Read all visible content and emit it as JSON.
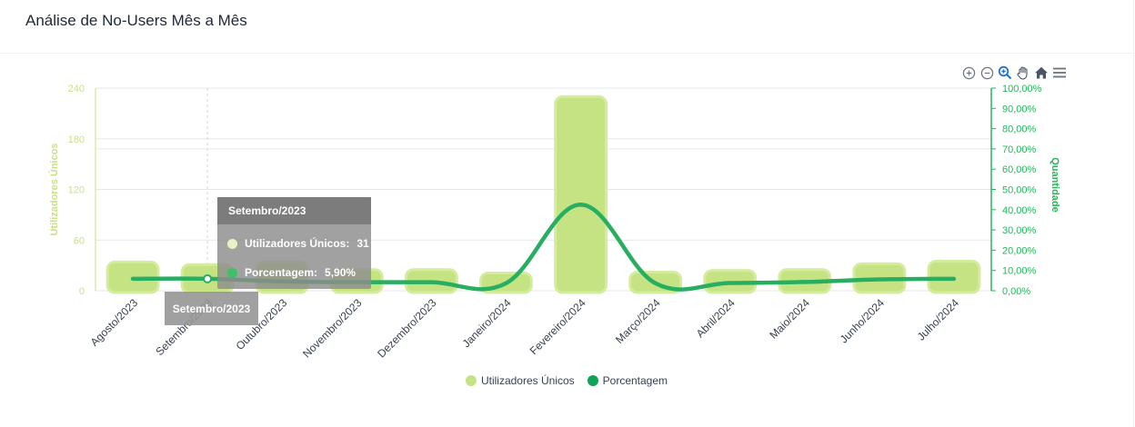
{
  "header": {
    "title": "Análise de No-Users Mês a Mês"
  },
  "toolbar": {
    "icons": [
      "zoom-in-icon",
      "zoom-out-icon",
      "selection-zoom-icon",
      "pan-hand-icon",
      "home-reset-icon",
      "menu-icon"
    ]
  },
  "colors": {
    "bar": "#c5e383",
    "line": "#27ae60",
    "left_axis": "#c5e383",
    "right_axis": "#22b859",
    "grid": "#e5e7eb",
    "tooltip_bg": "#8c8c8c"
  },
  "chart_data": {
    "type": "bar",
    "categories": [
      "Agosto/2023",
      "Setembro/2023",
      "Outubro/2023",
      "Novembro/2023",
      "Dezembro/2023",
      "Janeiro/2024",
      "Fevereiro/2024",
      "Março/2024",
      "Abril/2024",
      "Maio/2024",
      "Junho/2024",
      "Julho/2024"
    ],
    "series": [
      {
        "name": "Utilizadores Únicos",
        "axis": "left",
        "type": "bar",
        "values": [
          34,
          31,
          34,
          25,
          25,
          21,
          230,
          22,
          24,
          25,
          32,
          35
        ]
      },
      {
        "name": "Porcentagem",
        "axis": "right",
        "type": "line",
        "values": [
          5.9,
          5.9,
          4.6,
          4.2,
          4.2,
          3.7,
          42.5,
          3.7,
          3.8,
          4.3,
          5.6,
          5.9
        ]
      }
    ],
    "ylabel": "Utilizadores Únicos",
    "y2label": "Quantidade",
    "ylim": [
      0,
      240
    ],
    "y2lim": [
      0,
      100
    ],
    "yticks": [
      "0",
      "60",
      "120",
      "180",
      "240"
    ],
    "y2ticks": [
      "0,00%",
      "10,00%",
      "20,00%",
      "30,00%",
      "40,00%",
      "50,00%",
      "60,00%",
      "70,00%",
      "80,00%",
      "90,00%",
      "100,00%"
    ],
    "grid": true,
    "legend": "bottom-center",
    "tooltip": {
      "title": "Setembro/2023",
      "rows": [
        {
          "label": "Utilizadores Únicos:",
          "value": "31"
        },
        {
          "label": "Porcentagem:",
          "value": "5,90%"
        }
      ],
      "xaxis_label": "Setembro/2023"
    }
  }
}
